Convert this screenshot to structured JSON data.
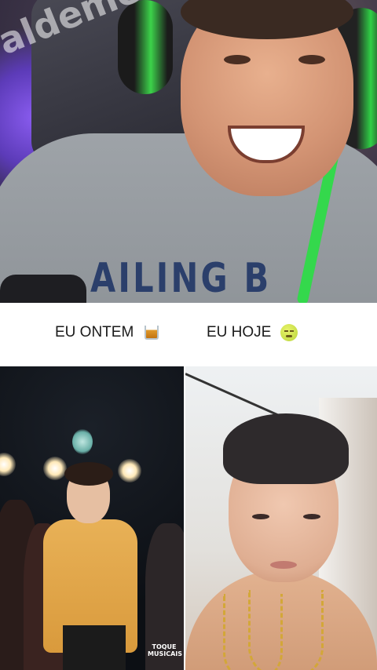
{
  "top_video": {
    "watermark": "aldememes",
    "shirt_text": "AILING B"
  },
  "captions": {
    "left": "EU ONTEM",
    "left_emoji": "tumbler-glass-icon",
    "right": "EU HOJE",
    "right_emoji": "nauseated-face-icon"
  },
  "bottom_left": {
    "logo_line1": "TOQUE",
    "logo_line2": "MUSICAIS"
  },
  "colors": {
    "caption_bg": "#ffffff",
    "caption_text": "#1a1a1a",
    "headphone_green": "#34d84c"
  }
}
